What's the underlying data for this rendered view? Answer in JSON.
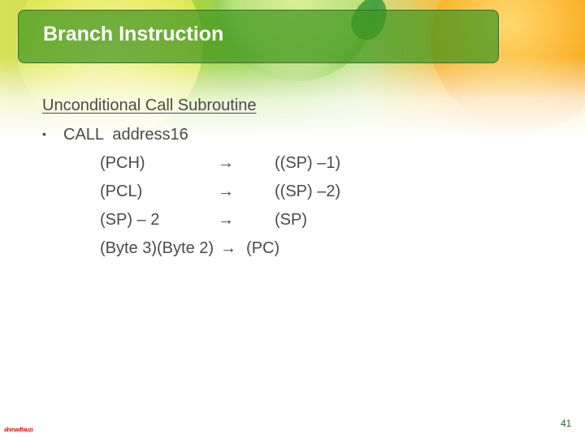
{
  "slide": {
    "title": "Branch Instruction",
    "heading": "Unconditional Call Subroutine",
    "bullet_symbol": "•",
    "bullet_text": "CALL  address16",
    "transfers": [
      {
        "source": "(PCH)",
        "arrow": "→",
        "destination": "((SP) –1)"
      },
      {
        "source": "(PCL)",
        "arrow": "→",
        "destination": "((SP) –2)"
      },
      {
        "source": "(SP) – 2",
        "arrow": "→",
        "destination": "(SP)"
      },
      {
        "source": "(Byte 3)(Byte 2)",
        "arrow": "→",
        "destination": "(PC)"
      }
    ],
    "footer_left": "ahmadfauzi",
    "page_number": "41"
  }
}
